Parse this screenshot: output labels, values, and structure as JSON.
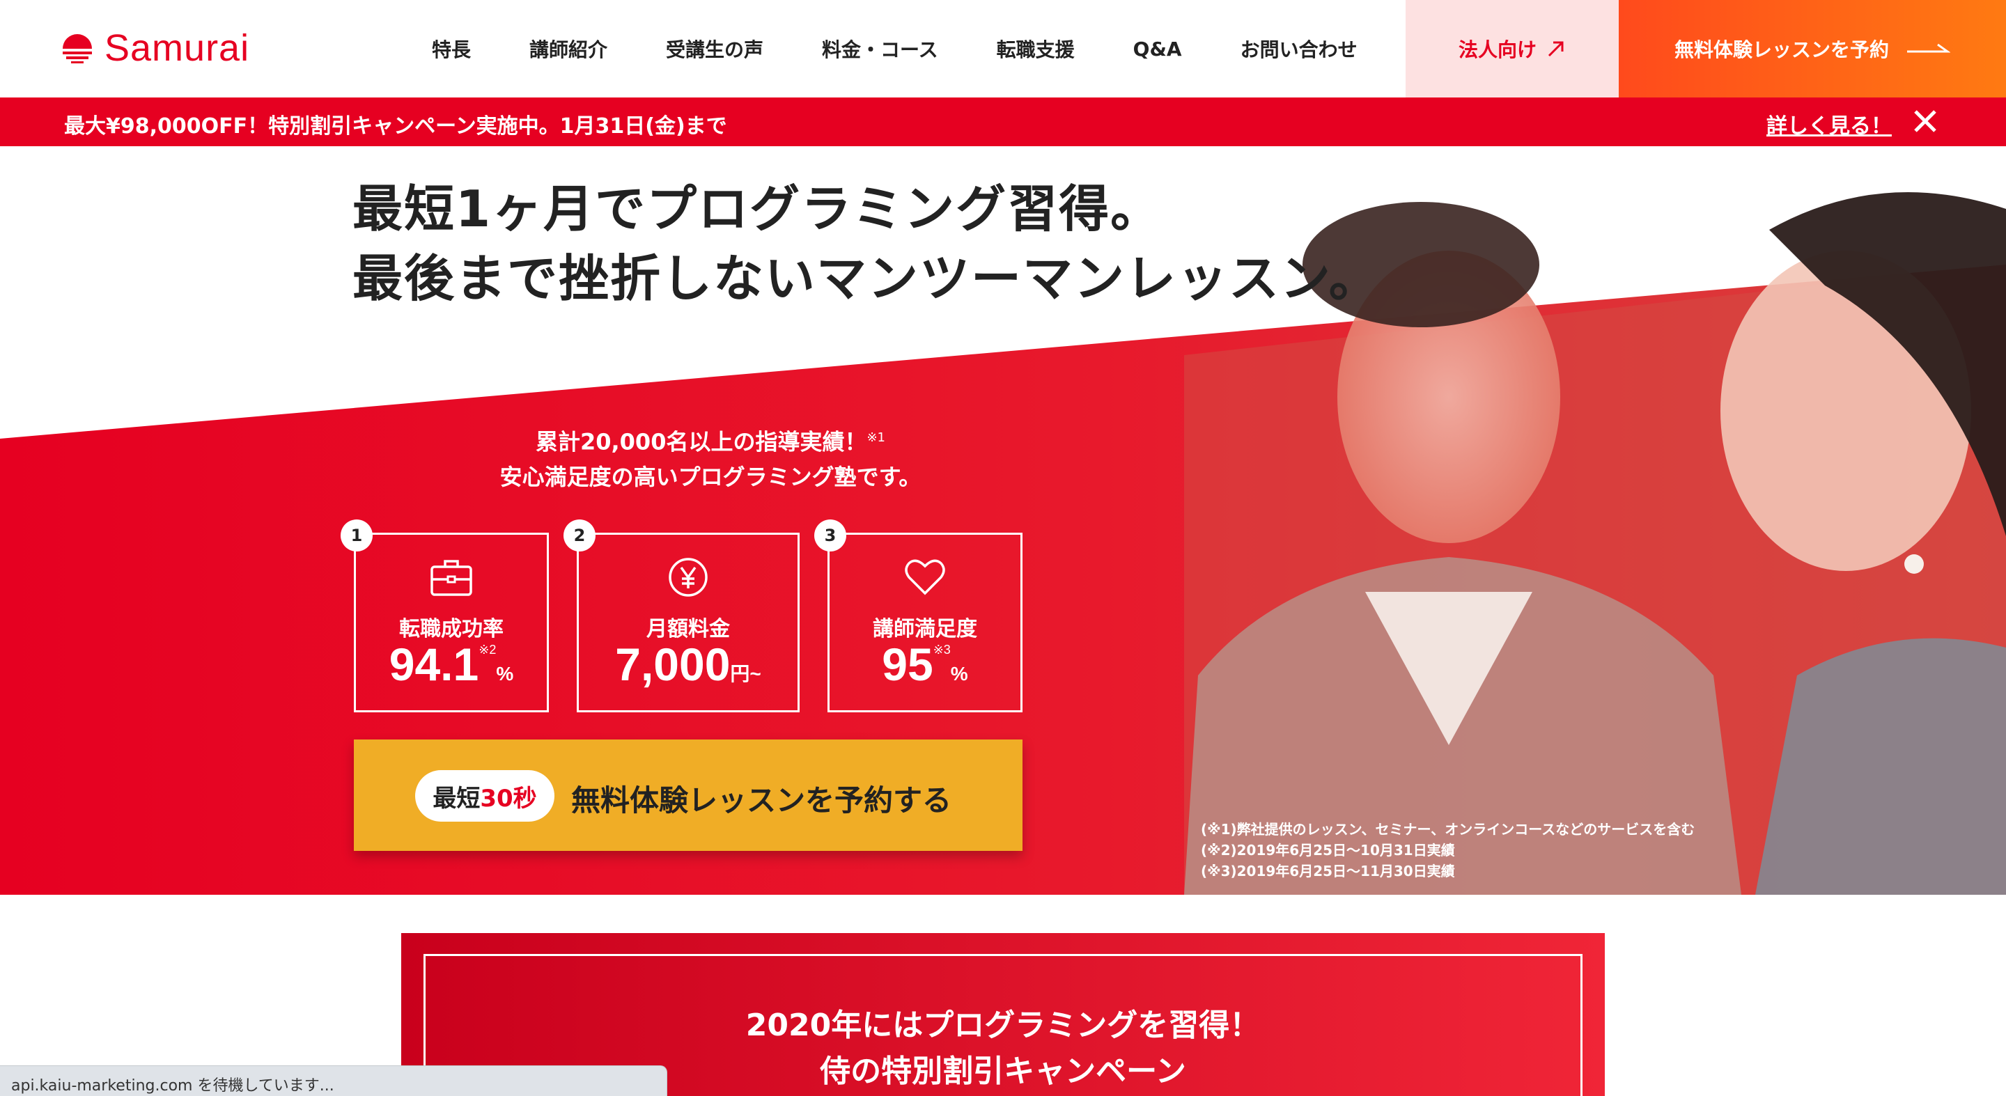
{
  "header": {
    "logo_text": "Samurai",
    "nav": [
      "特長",
      "講師紹介",
      "受講生の声",
      "料金・コース",
      "転職支援",
      "Q&A",
      "お問い合わせ"
    ],
    "corp_button": "法人向け",
    "trial_button": "無料体験レッスンを予約"
  },
  "campaign_bar": {
    "text": "最大¥98,000OFF！特別割引キャンペーン実施中。1月31日(金)まで",
    "link": "詳しく見る！"
  },
  "hero": {
    "headline_line1": "最短1ヶ月でプログラミング習得。",
    "headline_line2": "最後まで挫折しないマンツーマンレッスン。",
    "intro_line1": "累計20,000名以上の指導実績！",
    "intro_note": "※1",
    "intro_line2": "安心満足度の高いプログラミング塾です。",
    "stats": [
      {
        "num": "1",
        "icon": "briefcase-icon",
        "label": "転職成功率",
        "value": "94.1",
        "unit": "%",
        "note": "※2"
      },
      {
        "num": "2",
        "icon": "yen-icon",
        "label": "月額料金",
        "value": "7,000",
        "unit": "円~",
        "note": ""
      },
      {
        "num": "3",
        "icon": "heart-icon",
        "label": "講師満足度",
        "value": "95",
        "unit": "%",
        "note": "※3"
      }
    ],
    "cta_badge_prefix": "最短",
    "cta_badge_highlight": "30秒",
    "cta_text": "無料体験レッスンを予約する",
    "footnotes": [
      "(※1)弊社提供のレッスン、セミナー、オンラインコースなどのサービスを含む",
      "(※2)2019年6月25日〜10月31日実績",
      "(※3)2019年6月25日〜11月30日実績"
    ]
  },
  "promo": {
    "title_line1": "2020年にはプログラミングを習得！",
    "title_line2": "侍の特別割引キャンペーン"
  },
  "status_bar": "api.kaiu-marketing.com を待機しています...",
  "colors": {
    "brand_red": "#e60021",
    "cta_yellow": "#f0ad26",
    "trial_orange": "#ff5a18",
    "corp_pink": "#fde1e1"
  }
}
